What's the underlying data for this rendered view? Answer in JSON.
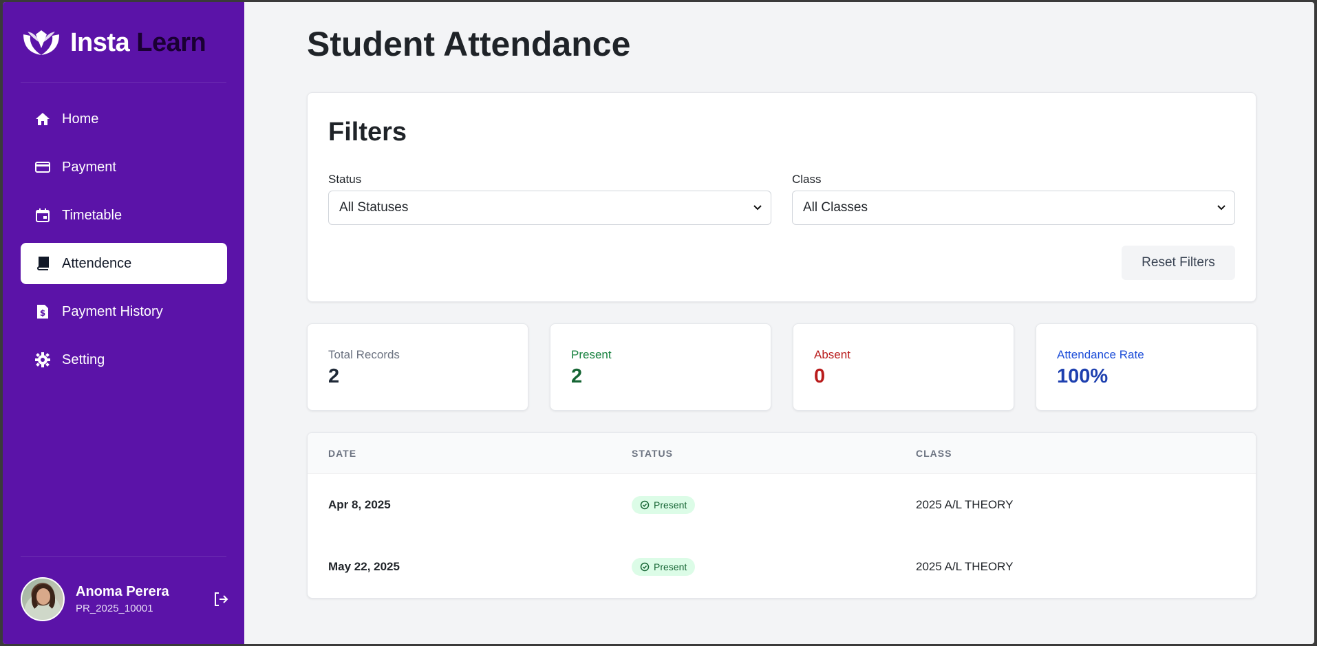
{
  "brand": {
    "word1": "Insta",
    "word2": "Learn"
  },
  "sidebar": {
    "items": [
      {
        "label": "Home",
        "icon": "home-icon"
      },
      {
        "label": "Payment",
        "icon": "credit-card-icon"
      },
      {
        "label": "Timetable",
        "icon": "calendar-icon"
      },
      {
        "label": "Attendence",
        "icon": "book-icon",
        "active": true
      },
      {
        "label": "Payment History",
        "icon": "dollar-file-icon"
      },
      {
        "label": "Setting",
        "icon": "gear-icon"
      }
    ]
  },
  "user": {
    "name": "Anoma Perera",
    "id": "PR_2025_10001"
  },
  "page": {
    "title": "Student Attendance"
  },
  "filters": {
    "title": "Filters",
    "status_label": "Status",
    "status_value": "All Statuses",
    "class_label": "Class",
    "class_value": "All Classes",
    "reset_label": "Reset Filters"
  },
  "stats": {
    "total": {
      "label": "Total Records",
      "value": "2",
      "color": "#1f2937"
    },
    "present": {
      "label": "Present",
      "value": "2",
      "color": "#166534"
    },
    "absent": {
      "label": "Absent",
      "value": "0",
      "color": "#b91c1c"
    },
    "rate": {
      "label": "Attendance Rate",
      "value": "100%",
      "color": "#1d4ed8"
    }
  },
  "table": {
    "headers": {
      "date": "DATE",
      "status": "STATUS",
      "class": "CLASS"
    },
    "rows": [
      {
        "date": "Apr 8, 2025",
        "status": "Present",
        "class": "2025 A/L THEORY"
      },
      {
        "date": "May 22, 2025",
        "status": "Present",
        "class": "2025 A/L THEORY"
      }
    ]
  },
  "colors": {
    "sidebar": "#5b13a8",
    "background": "#f3f4f6",
    "badge_bg": "#dcfce7",
    "badge_text": "#166534"
  }
}
